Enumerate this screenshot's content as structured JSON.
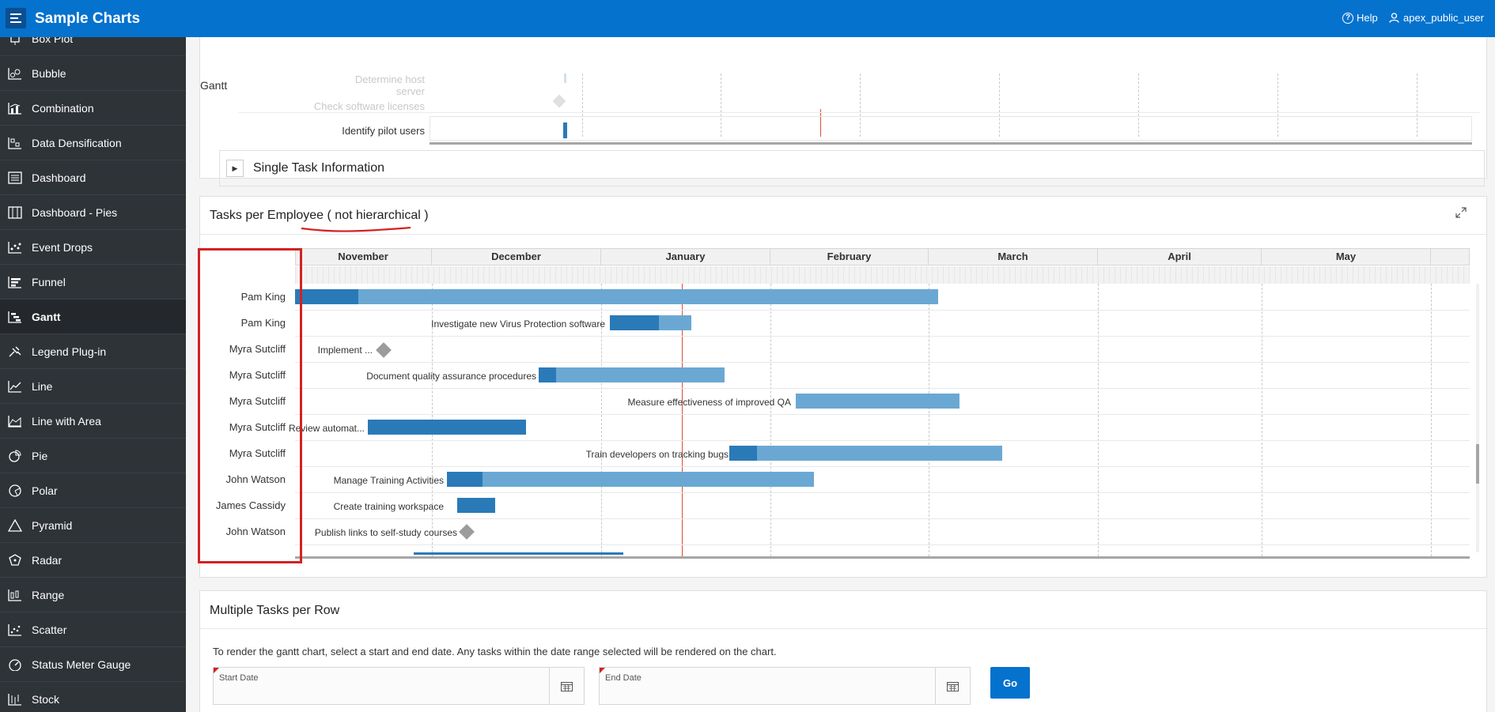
{
  "header": {
    "title": "Sample Charts",
    "help": "Help",
    "user": "apex_public_user"
  },
  "sidebar": {
    "items": [
      {
        "label": "Box Plot",
        "icon": "box-plot-icon"
      },
      {
        "label": "Bubble",
        "icon": "bubble-icon"
      },
      {
        "label": "Combination",
        "icon": "combination-icon"
      },
      {
        "label": "Data Densification",
        "icon": "data-densification-icon"
      },
      {
        "label": "Dashboard",
        "icon": "dashboard-icon"
      },
      {
        "label": "Dashboard - Pies",
        "icon": "dashboard-pies-icon"
      },
      {
        "label": "Event Drops",
        "icon": "event-drops-icon"
      },
      {
        "label": "Funnel",
        "icon": "funnel-icon"
      },
      {
        "label": "Gantt",
        "icon": "gantt-icon",
        "active": true
      },
      {
        "label": "Legend Plug-in",
        "icon": "legend-plugin-icon"
      },
      {
        "label": "Line",
        "icon": "line-icon"
      },
      {
        "label": "Line with Area",
        "icon": "line-with-area-icon"
      },
      {
        "label": "Pie",
        "icon": "pie-icon"
      },
      {
        "label": "Polar",
        "icon": "polar-icon"
      },
      {
        "label": "Pyramid",
        "icon": "pyramid-icon"
      },
      {
        "label": "Radar",
        "icon": "radar-icon"
      },
      {
        "label": "Range",
        "icon": "range-icon"
      },
      {
        "label": "Scatter",
        "icon": "scatter-icon"
      },
      {
        "label": "Status Meter Gauge",
        "icon": "status-meter-gauge-icon"
      },
      {
        "label": "Stock",
        "icon": "stock-icon"
      }
    ]
  },
  "top_region": {
    "page_tab": "Gantt",
    "faded_rows": [
      "Determine host server",
      "Check software licenses"
    ],
    "row_label": "Identify pilot users",
    "single_task_title": "Single Task Information"
  },
  "tasks_region": {
    "title_main": "Tasks per Employee",
    "title_annot": "( not hierarchical )",
    "months": [
      "November",
      "December",
      "January",
      "February",
      "March",
      "April",
      "May"
    ],
    "rows": [
      {
        "employee": "Pam King",
        "task": ""
      },
      {
        "employee": "Pam King",
        "task": "Investigate new Virus Protection software"
      },
      {
        "employee": "Myra Sutcliff",
        "task": "Implement ..."
      },
      {
        "employee": "Myra Sutcliff",
        "task": "Document quality assurance procedures"
      },
      {
        "employee": "Myra Sutcliff",
        "task": "Measure effectiveness of improved QA"
      },
      {
        "employee": "Myra Sutcliff",
        "task": "Review automat..."
      },
      {
        "employee": "Myra Sutcliff",
        "task": "Train developers on tracking bugs"
      },
      {
        "employee": "John Watson",
        "task": "Manage Training Activities"
      },
      {
        "employee": "James Cassidy",
        "task": "Create training workspace"
      },
      {
        "employee": "John Watson",
        "task": "Publish links to self-study courses"
      }
    ]
  },
  "multi_region": {
    "title": "Multiple Tasks per Row",
    "instructions": "To render the gantt chart, select a start and end date. Any tasks within the date range selected will be rendered on the chart.",
    "start_label": "Start Date",
    "end_label": "End Date",
    "go_label": "Go"
  },
  "colors": {
    "brand": "#0572ce",
    "bar_light": "#6aa8d3",
    "bar_dark": "#2a7ab8",
    "today_line": "#e04a3a",
    "annotation": "#d42121"
  }
}
